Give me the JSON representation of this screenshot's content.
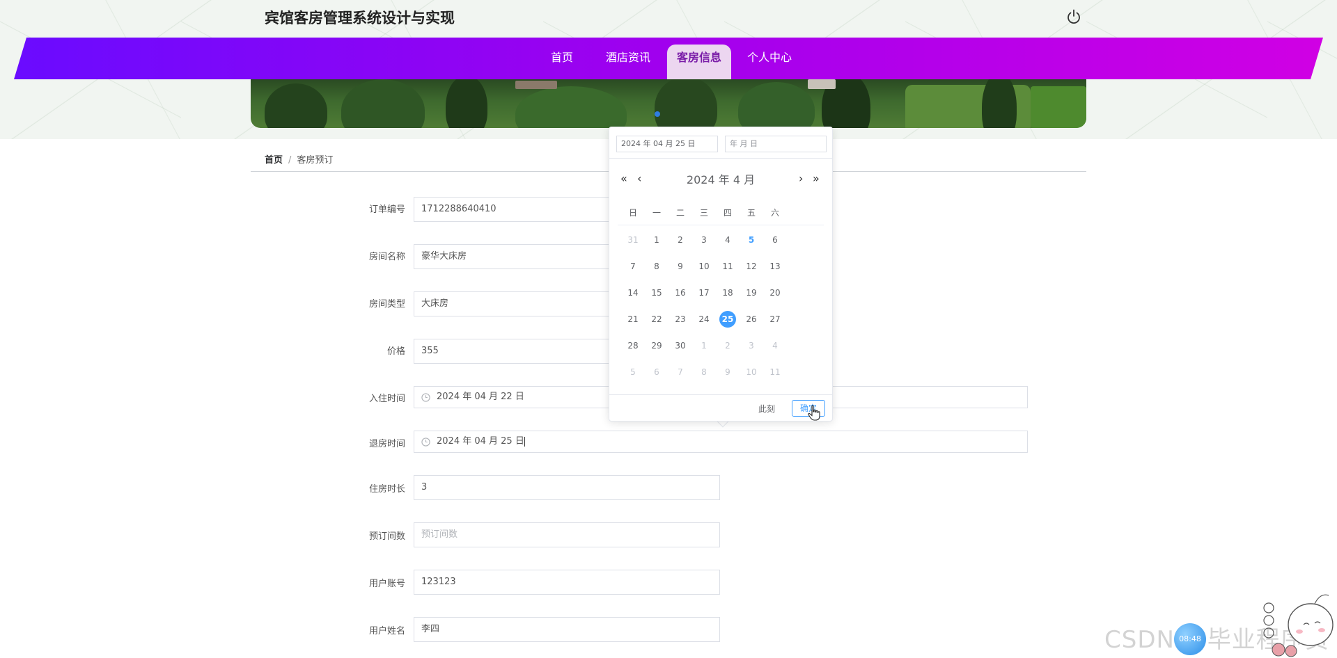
{
  "header": {
    "site_title": "宾馆客房管理系统设计与实现"
  },
  "nav": {
    "items": [
      {
        "label": "首页"
      },
      {
        "label": "酒店资讯"
      },
      {
        "label": "客房信息"
      },
      {
        "label": "个人中心"
      }
    ],
    "active": "客房信息"
  },
  "breadcrumb": {
    "home": "首页",
    "separator": "/",
    "current": "客房预订"
  },
  "form": {
    "order_no": {
      "label": "订单编号",
      "value": "1712288640410"
    },
    "room_name": {
      "label": "房间名称",
      "value": "豪华大床房"
    },
    "room_type": {
      "label": "房间类型",
      "value": "大床房"
    },
    "price": {
      "label": "价格",
      "value": "355"
    },
    "checkin": {
      "label": "入住时间",
      "value": "2024 年 04 月 22 日"
    },
    "checkout": {
      "label": "退房时间",
      "value": "2024 年 04 月 25 日"
    },
    "duration": {
      "label": "住房时长",
      "value": "3"
    },
    "rooms": {
      "label": "预订间数",
      "placeholder": "预订间数"
    },
    "account": {
      "label": "用户账号",
      "value": "123123"
    },
    "username": {
      "label": "用户姓名",
      "value": "李四"
    }
  },
  "datepicker": {
    "date_input": "2024 年 04 月 25 日",
    "time_input_placeholder": "年 月 日",
    "year_label": "2024 年",
    "month_label": "4 月",
    "prev_year": "«",
    "prev_month": "‹",
    "next_month": "›",
    "next_year": "»",
    "weekdays": [
      "日",
      "一",
      "二",
      "三",
      "四",
      "五",
      "六"
    ],
    "weeks": [
      [
        "31",
        "1",
        "2",
        "3",
        "4",
        "5",
        "6"
      ],
      [
        "7",
        "8",
        "9",
        "10",
        "11",
        "12",
        "13"
      ],
      [
        "14",
        "15",
        "16",
        "17",
        "18",
        "19",
        "20"
      ],
      [
        "21",
        "22",
        "23",
        "24",
        "25",
        "26",
        "27"
      ],
      [
        "28",
        "29",
        "30",
        "1",
        "2",
        "3",
        "4"
      ],
      [
        "5",
        "6",
        "7",
        "8",
        "9",
        "10",
        "11"
      ]
    ],
    "today": "5",
    "selected": "25",
    "now_label": "此刻",
    "confirm_label": "确定"
  },
  "watermark": "CSDN @毕业程序员",
  "float_button": "08:48",
  "colors": {
    "nav_gradient_start": "#6a0bff",
    "nav_gradient_end": "#d000e4",
    "accent": "#409eff",
    "active_tab_bg": "#ecd6f0"
  }
}
